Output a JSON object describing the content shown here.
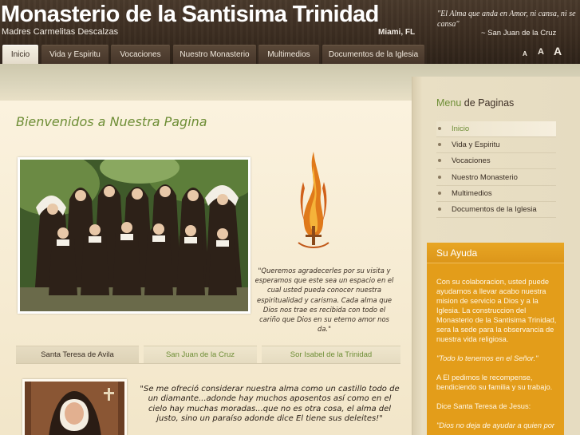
{
  "header": {
    "title": "Monasterio de la Santisima Trinidad",
    "subtitle": "Madres Carmelitas Descalzas",
    "location": "Miami, FL",
    "quote": "\"El Alma que anda en Amor, ni cansa, ni se cansa\"",
    "quote_author": "~ San Juan de la Cruz"
  },
  "nav": {
    "items": [
      {
        "label": "Inicio",
        "active": true
      },
      {
        "label": "Vida y Espiritu"
      },
      {
        "label": "Vocaciones"
      },
      {
        "label": "Nuestro Monasterio"
      },
      {
        "label": "Multimedios"
      },
      {
        "label": "Documentos de la Iglesia"
      }
    ]
  },
  "font_size_controls": [
    "A",
    "A",
    "A"
  ],
  "main": {
    "welcome": "Bienvenidos a Nuestra Pagina",
    "intro": "\"Queremos agradecerles por su visita y esperamos que este sea un espacio en el cual usted pueda conocer nuestra espiritualidad y carisma. Cada alma que Dios nos trae es recibida con todo el cariño que Dios en su eterno amor nos da.\"",
    "tabs": [
      {
        "label": "Santa Teresa de Avila",
        "active": true
      },
      {
        "label": "San Juan de la Cruz"
      },
      {
        "label": "Sor Isabel de la Trinidad"
      }
    ],
    "teresa_quote": "\"Se me ofreció considerar nuestra alma como un castillo todo de un diamante...adonde hay muchos aposentos así como en el cielo hay muchas moradas...que no es otra cosa, el alma del justo, sino un paraíso adonde dice El tiene sus deleites!\""
  },
  "sidebar": {
    "menu_title_first": "Menu",
    "menu_title_rest": " de Paginas",
    "menu_items": [
      {
        "label": "Inicio",
        "active": true
      },
      {
        "label": "Vida y Espiritu"
      },
      {
        "label": "Vocaciones"
      },
      {
        "label": "Nuestro Monasterio"
      },
      {
        "label": "Multimedios"
      },
      {
        "label": "Documentos de la Iglesia"
      }
    ],
    "help_title": "Su Ayuda",
    "help_paragraphs": [
      "Con su colaboracion, usted puede ayudarnos a llevar acabo nuestra mision de servicio a Dios y a la Iglesia. La construccion del Monasterio de la Santisima Trinidad, sera la sede para la observancia de nuestra vida religiosa.",
      "\"Todo lo tenemos en el Señor.\"",
      "A El pedimos le recompense, bendiciendo su familia y su trabajo.",
      "Dice Santa Teresa de Jesus:",
      "\"Dios no deja de ayudar a quien por"
    ]
  },
  "colors": {
    "accent_green": "#6e8e36",
    "header_brown": "#3a2c20",
    "help_orange": "#e39d1a"
  }
}
